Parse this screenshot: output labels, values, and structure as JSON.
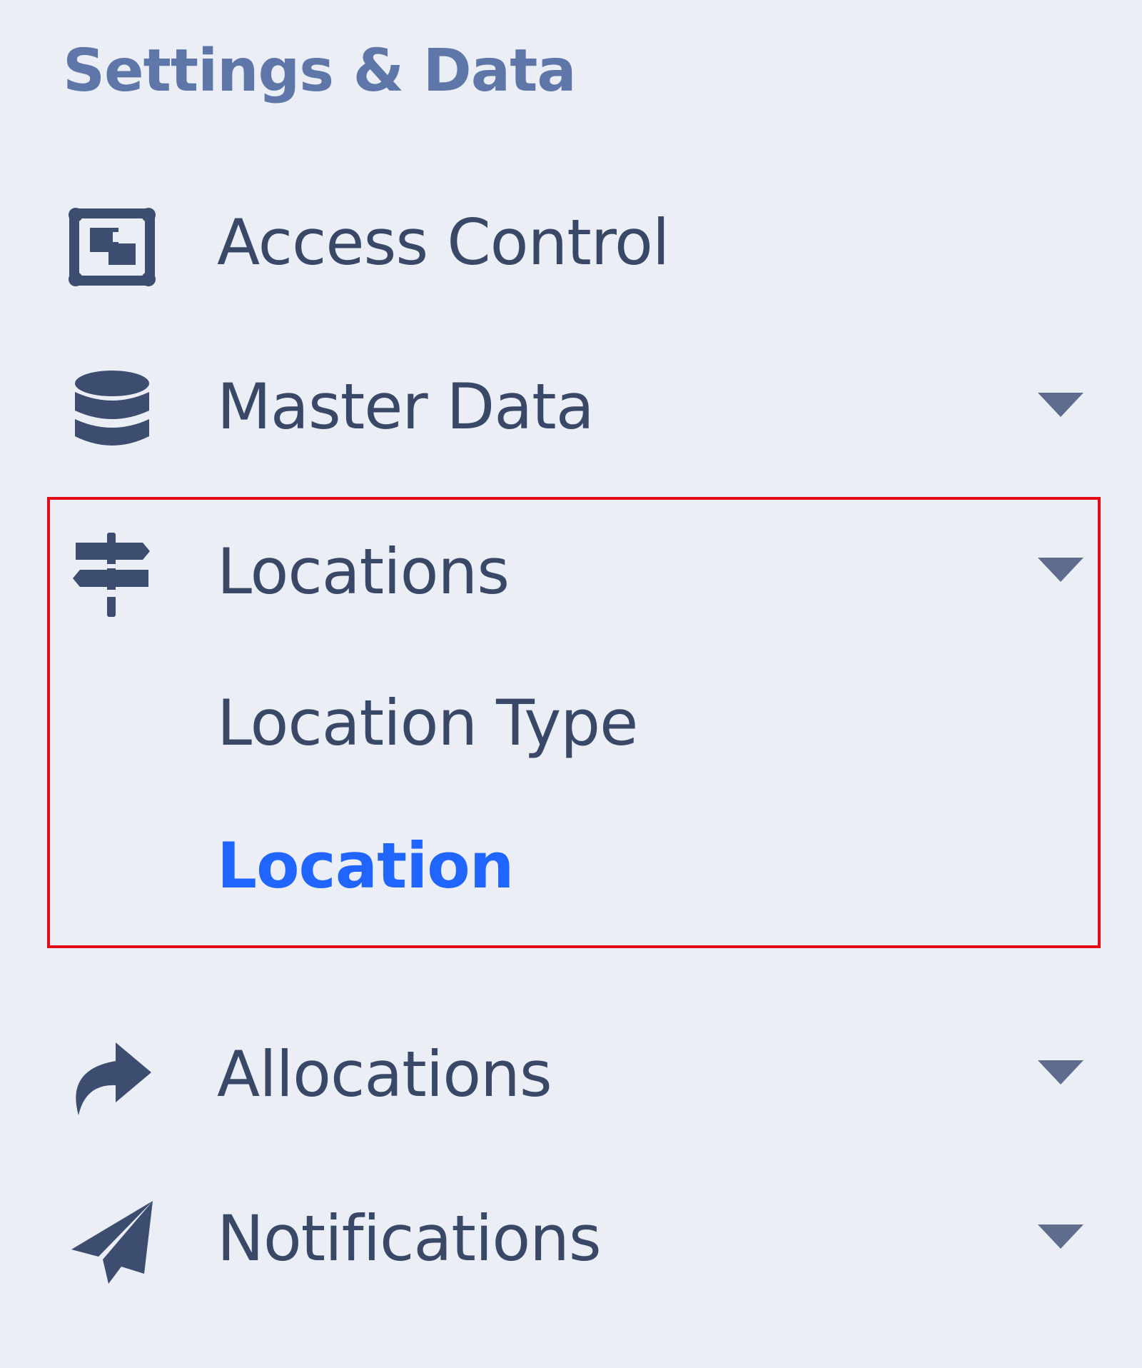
{
  "sidebar": {
    "section_title": "Settings & Data",
    "items": [
      {
        "label": "Access Control",
        "icon": "access-control-icon",
        "has_caret": false
      },
      {
        "label": "Master Data",
        "icon": "database-icon",
        "has_caret": true
      },
      {
        "label": "Locations",
        "icon": "signpost-icon",
        "has_caret": true,
        "expanded": true,
        "children": [
          {
            "label": "Location Type",
            "active": false
          },
          {
            "label": "Location",
            "active": true
          }
        ]
      },
      {
        "label": "Allocations",
        "icon": "share-arrow-icon",
        "has_caret": true
      },
      {
        "label": "Notifications",
        "icon": "paper-plane-icon",
        "has_caret": true
      }
    ]
  },
  "colors": {
    "background": "#eceef5",
    "section_title": "#5f76a9",
    "text": "#3a4868",
    "active": "#2065ff",
    "highlight_border": "#e30b17"
  }
}
